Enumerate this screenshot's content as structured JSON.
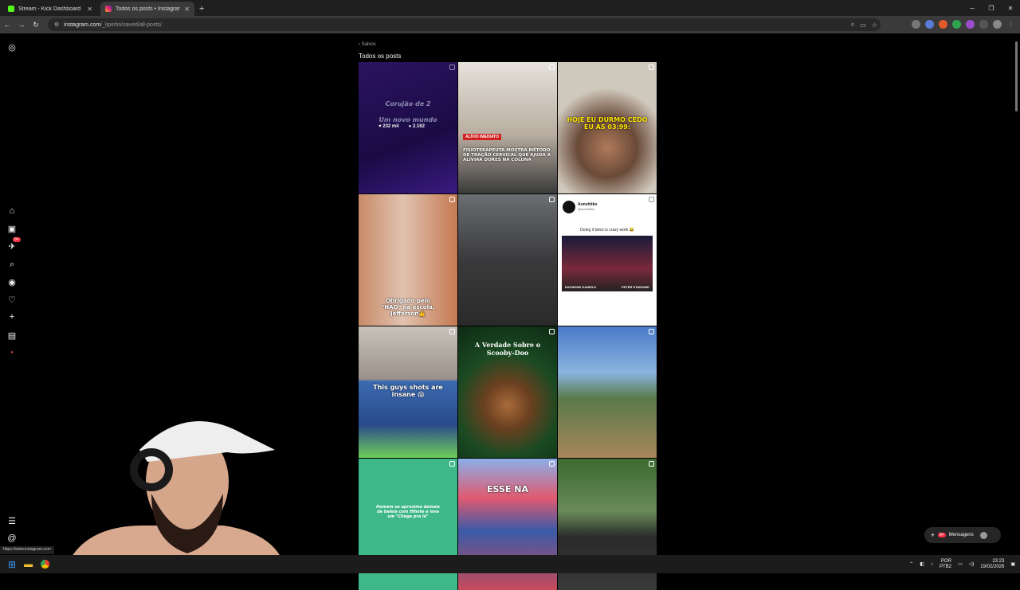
{
  "browser": {
    "tabs": [
      {
        "title": "Stream - Kick Dashboard",
        "active": false,
        "favicon_color": "#53fc18"
      },
      {
        "title": "Todos os posts • Instagram",
        "active": true,
        "favicon_color": "#e1306c"
      }
    ],
    "url_host": "instagram.com",
    "url_path": "/_lipinho/saved/all-posts/",
    "status_url": "https://www.instagram.com"
  },
  "instagram": {
    "breadcrumb": "Salvos",
    "page_title": "Todos os posts",
    "messages_label": "Mensagens",
    "messages_badge": "9+",
    "notifications_badge": "9+",
    "posts": [
      {
        "caption_top": "Corujão de 2",
        "caption_bottom": "Um novo mundo",
        "likes": "232 mil",
        "comments": "2.162",
        "bg": "#2a1060"
      },
      {
        "tag": "ALÍVIO IMEDIATO",
        "caption": "FISIOTERAPEUTA MOSTRA MÉTODO DE TRAÇÃO CERVICAL QUE AJUDA A ALIVIAR DORES NA COLUNA",
        "bg": "#c9c2b8"
      },
      {
        "caption": "HOJE EU DURMO CEDO EU AS 03:99:",
        "bg": "#9a8f80"
      },
      {
        "caption": "Obrigado pelo \"NÃO\" na escola, Jefferson👍",
        "bg": "#b88b68"
      },
      {
        "caption": "",
        "bg": "#4a4b4d"
      },
      {
        "tweet_name": "Aonehitko",
        "tweet_handle": "@aonehitko",
        "tweet_text": "Doing it twice is crazy work 😂",
        "fighter_left": "RAYMOND DANIELS",
        "fighter_right": "PETER STANONIK",
        "bg": "#ffffff"
      },
      {
        "caption": "This guys shots are insane 😱",
        "bg": "#3c5a8a"
      },
      {
        "caption": "A Verdade Sobre o Scooby-Doo",
        "bg": "#1e4a2a"
      },
      {
        "caption": "",
        "bg": "#6f8fc0"
      },
      {
        "caption": "Homem se aproxima demais de baleia com filhote e leva um \"Chega pra lá\"",
        "bg": "#3fb889"
      },
      {
        "caption": "ESSE NA",
        "bg": "#3d5fa8"
      },
      {
        "caption": "",
        "bg": "#5a7a55"
      }
    ]
  },
  "taskbar": {
    "lang_top": "POR",
    "lang_bottom": "PTB2",
    "time": "23:23",
    "date": "19/02/2026"
  }
}
